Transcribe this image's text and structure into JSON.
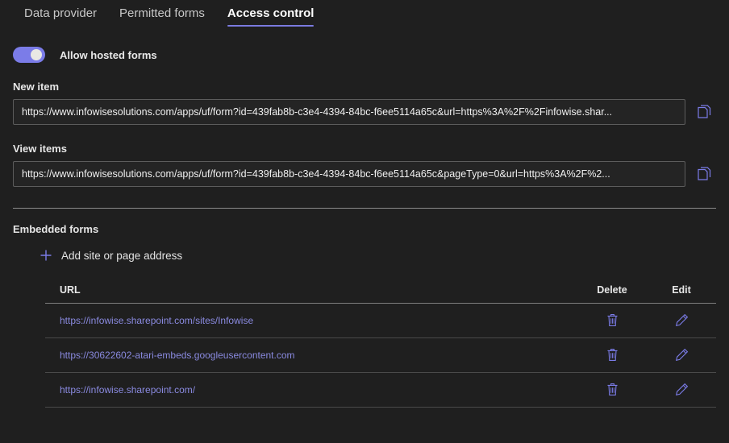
{
  "tabs": [
    {
      "label": "Data provider",
      "active": false
    },
    {
      "label": "Permitted forms",
      "active": false
    },
    {
      "label": "Access control",
      "active": true
    }
  ],
  "toggle": {
    "label": "Allow hosted forms",
    "state": "on",
    "accent": "#7b7ce8",
    "knob_color": "#e8e8e4"
  },
  "fields": {
    "new_item": {
      "label": "New item",
      "value": "https://www.infowisesolutions.com/apps/uf/form?id=439fab8b-c3e4-4394-84bc-f6ee5114a65c&url=https%3A%2F%2Finfowise.shar...",
      "copy_icon": "copy-icon"
    },
    "view_items": {
      "label": "View items",
      "value": "https://www.infowisesolutions.com/apps/uf/form?id=439fab8b-c3e4-4394-84bc-f6ee5114a65c&pageType=0&url=https%3A%2F%2...",
      "copy_icon": "copy-icon"
    }
  },
  "embedded": {
    "title": "Embedded forms",
    "add_label": "Add site or page address",
    "add_icon": "plus-icon",
    "columns": [
      "URL",
      "Delete",
      "Edit"
    ],
    "rows": [
      {
        "url": "https://infowise.sharepoint.com/sites/Infowise",
        "delete_icon": "trash-icon",
        "edit_icon": "pencil-icon"
      },
      {
        "url": "https://30622602-atari-embeds.googleusercontent.com",
        "delete_icon": "trash-icon",
        "edit_icon": "pencil-icon"
      },
      {
        "url": "https://infowise.sharepoint.com/",
        "delete_icon": "trash-icon",
        "edit_icon": "pencil-icon"
      }
    ]
  },
  "colors": {
    "background": "#1f1f1f",
    "accent_purple": "#7b7be0",
    "link_purple": "#8a8ae0",
    "text_primary": "#e6e6e6",
    "text_muted": "#c8c8c8",
    "input_border": "#5c5c5c"
  }
}
